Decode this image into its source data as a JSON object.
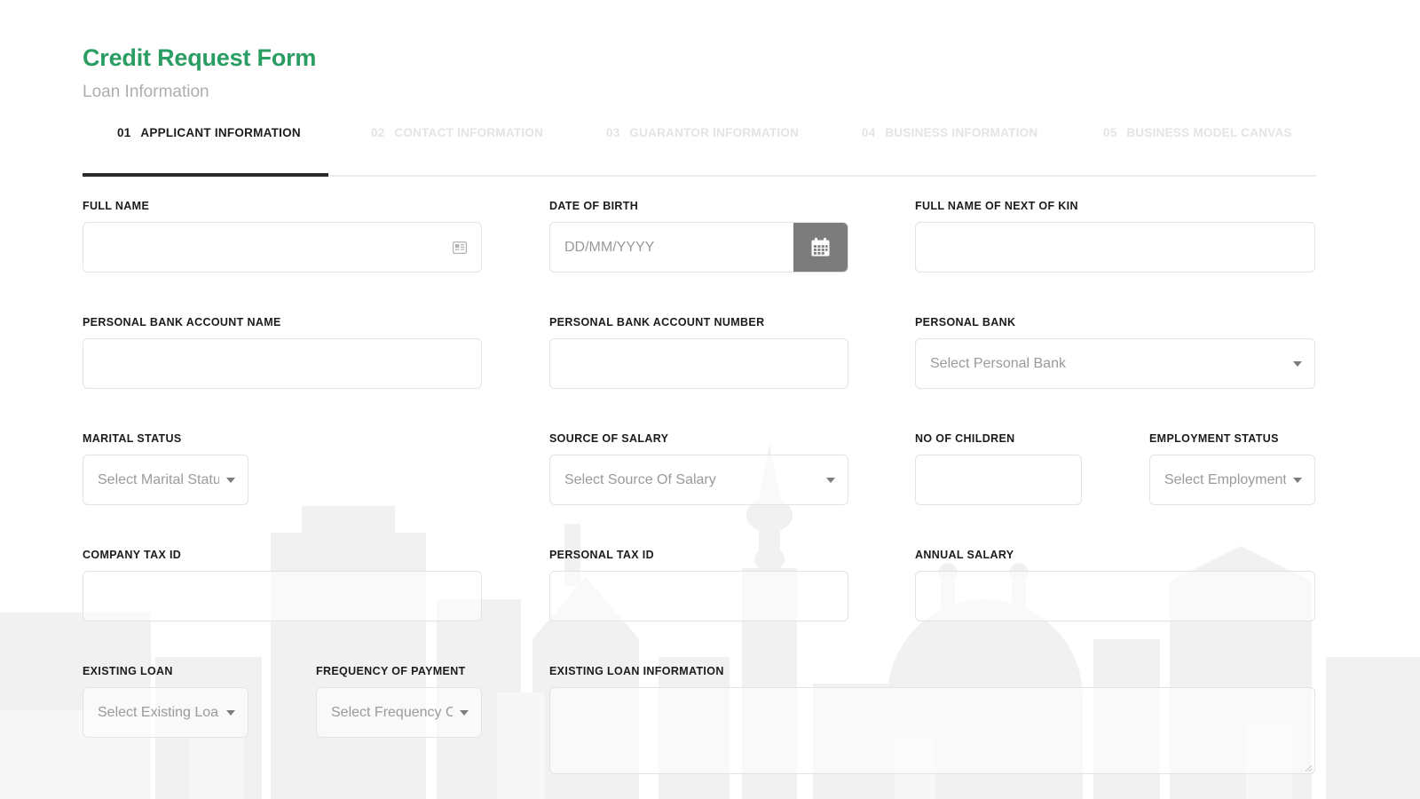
{
  "header": {
    "title": "Credit Request Form",
    "subtitle": "Loan Information",
    "accent_color": "#2a9d63",
    "subtitle_color": "#aeaeae"
  },
  "stepper": {
    "active_index": 0,
    "active_color": "#1d1d1d",
    "inactive_color": "#e4e4e4",
    "progress_color": "#2b2b2b",
    "steps": [
      {
        "number": "01",
        "label": "APPLICANT INFORMATION",
        "state": "active"
      },
      {
        "number": "02",
        "label": "CONTACT INFORMATION",
        "state": "inactive"
      },
      {
        "number": "03",
        "label": "GUARANTOR INFORMATION",
        "state": "inactive"
      },
      {
        "number": "04",
        "label": "BUSINESS INFORMATION",
        "state": "inactive"
      },
      {
        "number": "05",
        "label": "BUSINESS MODEL CANVAS",
        "state": "inactive"
      }
    ]
  },
  "fields": {
    "full_name": {
      "label": "FULL NAME",
      "value": "",
      "placeholder": "",
      "icon": "id-card-icon"
    },
    "date_of_birth": {
      "label": "DATE OF BIRTH",
      "value": "",
      "placeholder": "DD/MM/YYYY",
      "button_icon": "calendar-icon",
      "button_color": "#7c7c7c"
    },
    "full_name_next_of_kin": {
      "label": "FULL NAME OF NEXT OF KIN",
      "value": "",
      "placeholder": ""
    },
    "personal_bank_account_name": {
      "label": "PERSONAL BANK ACCOUNT NAME",
      "value": "",
      "placeholder": ""
    },
    "personal_bank_account_number": {
      "label": "PERSONAL BANK ACCOUNT NUMBER",
      "value": "",
      "placeholder": ""
    },
    "personal_bank": {
      "label": "PERSONAL BANK",
      "value": "Select Personal Bank"
    },
    "marital_status": {
      "label": "MARITAL STATUS",
      "value": "Select Marital Status"
    },
    "source_of_salary": {
      "label": "SOURCE OF SALARY",
      "value": "Select Source Of Salary"
    },
    "no_of_children": {
      "label": "NO OF CHILDREN",
      "value": "",
      "placeholder": ""
    },
    "employment_status": {
      "label": "EMPLOYMENT STATUS",
      "value": "Select Employment Status"
    },
    "company_tax_id": {
      "label": "COMPANY TAX ID",
      "value": "",
      "placeholder": ""
    },
    "personal_tax_id": {
      "label": "PERSONAL TAX ID",
      "value": "",
      "placeholder": ""
    },
    "annual_salary": {
      "label": "ANNUAL SALARY",
      "value": "",
      "placeholder": ""
    },
    "existing_loan": {
      "label": "EXISTING LOAN",
      "value": "Select Existing Loan"
    },
    "frequency_of_payment": {
      "label": "FREQUENCY OF PAYMENT",
      "value": "Select Frequency Of Payment"
    },
    "existing_loan_information": {
      "label": "EXISTING LOAN INFORMATION",
      "value": "",
      "placeholder": ""
    }
  }
}
